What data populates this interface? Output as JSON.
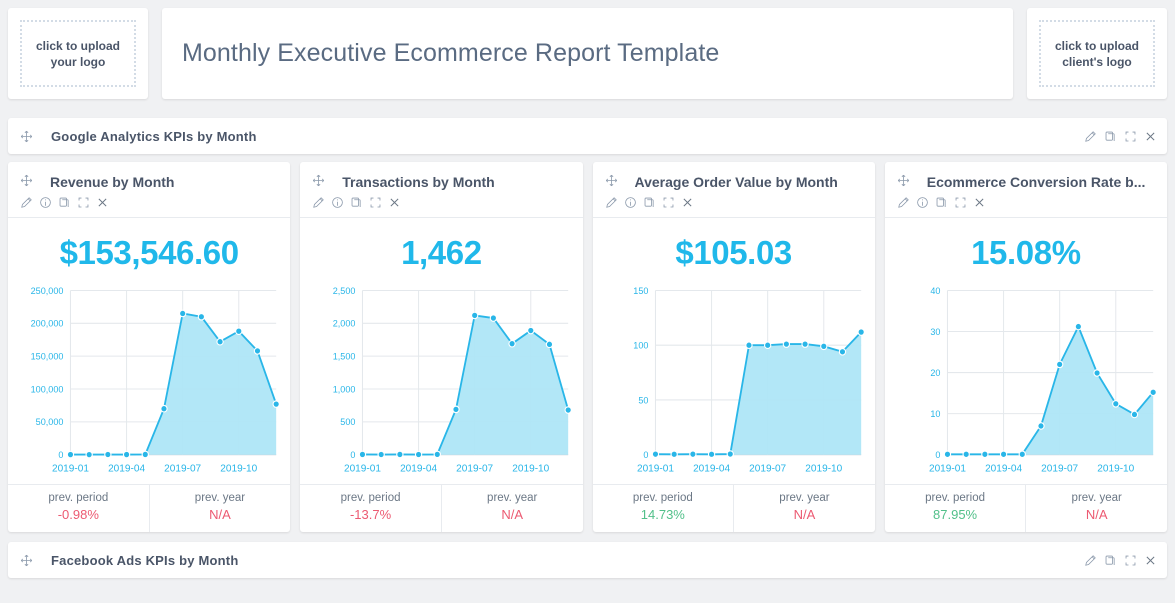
{
  "header": {
    "left_logo_line1": "click to upload",
    "left_logo_line2": "your logo",
    "title": "Monthly Executive Ecommerce Report Template",
    "right_logo_line1": "click to upload",
    "right_logo_line2": "client's logo"
  },
  "sections": {
    "ga": {
      "title": "Google Analytics KPIs by Month"
    },
    "fb": {
      "title": "Facebook Ads KPIs by Month"
    }
  },
  "tool_icons": {
    "move": "move-icon",
    "edit": "pencil-icon",
    "info": "info-icon",
    "copy": "copy-icon",
    "expand": "expand-icon",
    "close": "close-icon"
  },
  "footer_labels": {
    "prev_period": "prev. period",
    "prev_year": "prev. year"
  },
  "accent": "#29b6e8",
  "widgets": [
    {
      "title": "Revenue by Month",
      "kpi": "$153,546.60",
      "prev_period": "-0.98%",
      "prev_period_sign": "neg",
      "prev_year": "N/A",
      "prev_year_sign": "neg"
    },
    {
      "title": "Transactions by Month",
      "kpi": "1,462",
      "prev_period": "-13.7%",
      "prev_period_sign": "neg",
      "prev_year": "N/A",
      "prev_year_sign": "neg"
    },
    {
      "title": "Average Order Value by Month",
      "kpi": "$105.03",
      "prev_period": "14.73%",
      "prev_period_sign": "pos",
      "prev_year": "N/A",
      "prev_year_sign": "neg"
    },
    {
      "title": "Ecommerce Conversion Rate b...",
      "kpi": "15.08%",
      "prev_period": "87.95%",
      "prev_period_sign": "pos",
      "prev_year": "N/A",
      "prev_year_sign": "neg"
    }
  ],
  "chart_data": [
    {
      "type": "area",
      "title": "Revenue by Month",
      "x": [
        "2019-01",
        "2019-02",
        "2019-03",
        "2019-04",
        "2019-05",
        "2019-06",
        "2019-07",
        "2019-08",
        "2019-09",
        "2019-10",
        "2019-11",
        "2019-12"
      ],
      "xtick_labels": [
        "2019-01",
        "2019-04",
        "2019-07",
        "2019-10"
      ],
      "xtick_indices": [
        0,
        3,
        6,
        9
      ],
      "values": [
        200,
        150,
        300,
        200,
        400,
        70000,
        215000,
        210000,
        172000,
        188000,
        158000,
        77000
      ],
      "yticks": [
        0,
        50000,
        100000,
        150000,
        200000,
        250000
      ],
      "ytick_labels": [
        "0",
        "50,000",
        "100,000",
        "150,000",
        "200,000",
        "250,000"
      ],
      "ylim": [
        0,
        250000
      ],
      "xlabel": "",
      "ylabel": "",
      "grid": true,
      "legend": "none"
    },
    {
      "type": "area",
      "title": "Transactions by Month",
      "x": [
        "2019-01",
        "2019-02",
        "2019-03",
        "2019-04",
        "2019-05",
        "2019-06",
        "2019-07",
        "2019-08",
        "2019-09",
        "2019-10",
        "2019-11",
        "2019-12"
      ],
      "xtick_labels": [
        "2019-01",
        "2019-04",
        "2019-07",
        "2019-10"
      ],
      "xtick_indices": [
        0,
        3,
        6,
        9
      ],
      "values": [
        4,
        3,
        4,
        3,
        5,
        690,
        2120,
        2080,
        1690,
        1890,
        1680,
        680
      ],
      "yticks": [
        0,
        500,
        1000,
        1500,
        2000,
        2500
      ],
      "ytick_labels": [
        "0",
        "500",
        "1,000",
        "1,500",
        "2,000",
        "2,500"
      ],
      "ylim": [
        0,
        2500
      ],
      "xlabel": "",
      "ylabel": "",
      "grid": true,
      "legend": "none"
    },
    {
      "type": "area",
      "title": "Average Order Value by Month",
      "x": [
        "2019-01",
        "2019-02",
        "2019-03",
        "2019-04",
        "2019-05",
        "2019-06",
        "2019-07",
        "2019-08",
        "2019-09",
        "2019-10",
        "2019-11",
        "2019-12"
      ],
      "xtick_labels": [
        "2019-01",
        "2019-04",
        "2019-07",
        "2019-10"
      ],
      "xtick_indices": [
        0,
        3,
        6,
        9
      ],
      "values": [
        0.5,
        0.4,
        0.5,
        0.4,
        0.6,
        100,
        100,
        101,
        101,
        99,
        94,
        112
      ],
      "yticks": [
        0,
        50,
        100,
        150
      ],
      "ytick_labels": [
        "0",
        "50",
        "100",
        "150"
      ],
      "ylim": [
        0,
        150
      ],
      "xlabel": "",
      "ylabel": "",
      "grid": true,
      "legend": "none"
    },
    {
      "type": "area",
      "title": "Ecommerce Conversion Rate by Month",
      "x": [
        "2019-01",
        "2019-02",
        "2019-03",
        "2019-04",
        "2019-05",
        "2019-06",
        "2019-07",
        "2019-08",
        "2019-09",
        "2019-10",
        "2019-11",
        "2019-12"
      ],
      "xtick_labels": [
        "2019-01",
        "2019-04",
        "2019-07",
        "2019-10"
      ],
      "xtick_indices": [
        0,
        3,
        6,
        9
      ],
      "values": [
        0.1,
        0.1,
        0.1,
        0.1,
        0.1,
        7.0,
        22.0,
        31.2,
        19.9,
        12.4,
        9.8,
        15.2
      ],
      "yticks": [
        0,
        10,
        20,
        30,
        40
      ],
      "ytick_labels": [
        "0",
        "10",
        "20",
        "30",
        "40"
      ],
      "ylim": [
        0,
        40
      ],
      "xlabel": "",
      "ylabel": "",
      "grid": true,
      "legend": "none"
    }
  ]
}
